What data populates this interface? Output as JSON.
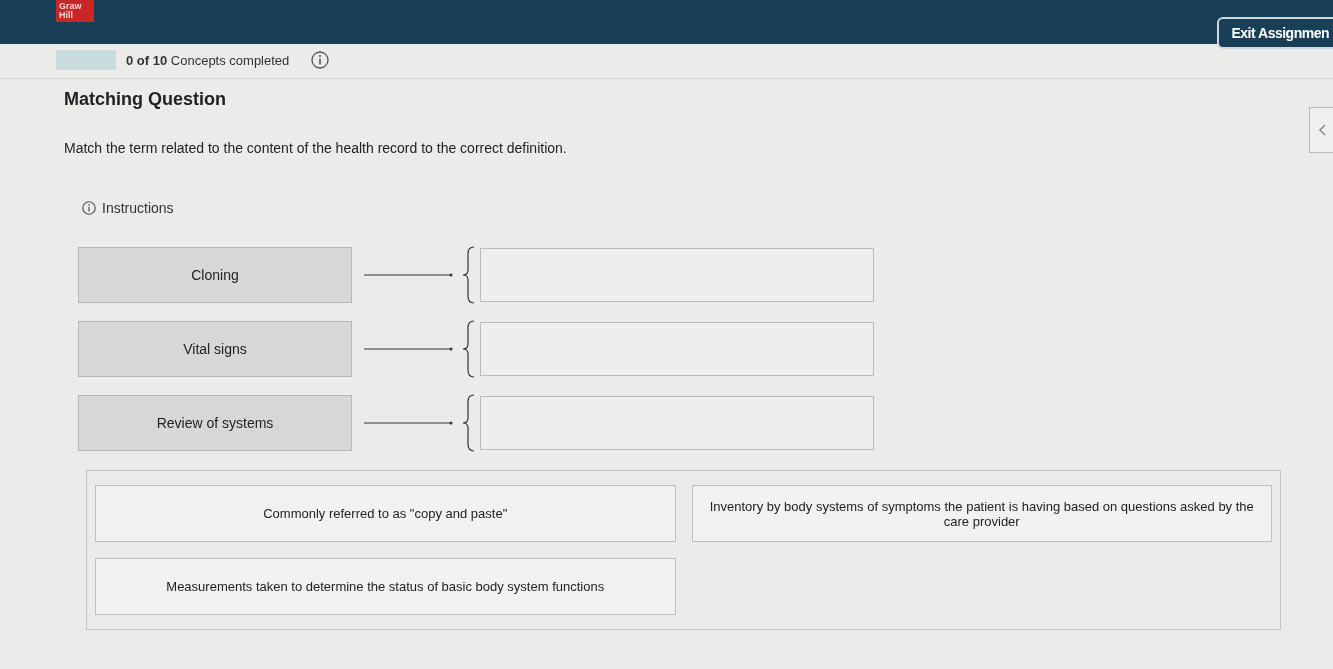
{
  "header": {
    "logo_lines": [
      "Graw",
      "Hill"
    ],
    "exit_button": "Exit Assignmen"
  },
  "progress": {
    "level": 0,
    "completed": "0 of 10",
    "label": "Concepts completed"
  },
  "question": {
    "title": "Matching Question",
    "prompt": "Match the term related to the content of the health record to the correct definition.",
    "instructions": "Instructions"
  },
  "terms": [
    {
      "label": "Cloning"
    },
    {
      "label": "Vital signs"
    },
    {
      "label": "Review of systems"
    }
  ],
  "answer_bank": [
    {
      "text": "Commonly referred to as \"copy and paste\""
    },
    {
      "text": "Inventory by body systems of symptoms the patient is having based on questions asked by the care provider"
    },
    {
      "text": "Measurements taken to determine the status of basic body system functions"
    }
  ]
}
